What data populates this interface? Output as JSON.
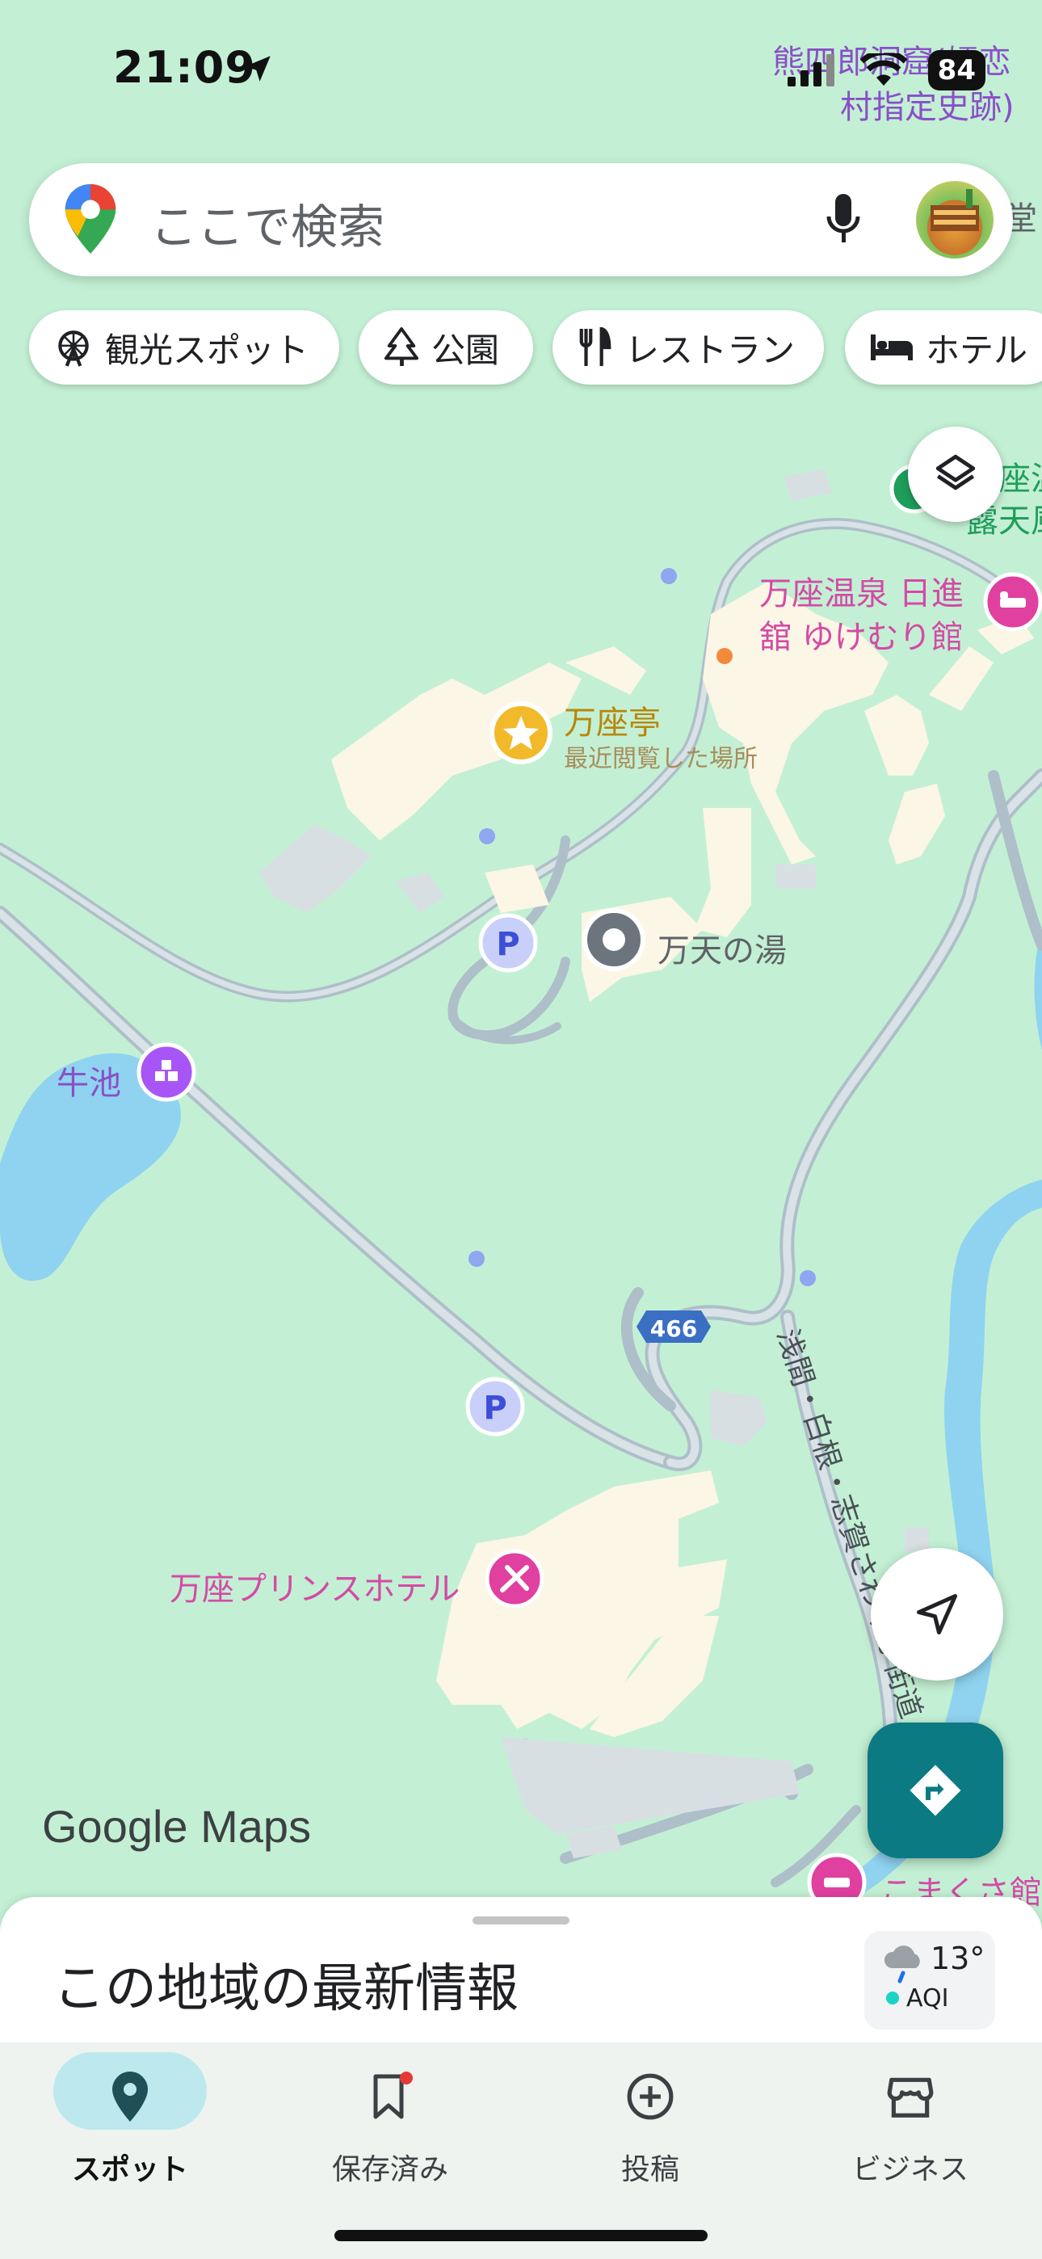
{
  "status_bar": {
    "time": "21:09",
    "battery": "84"
  },
  "search": {
    "placeholder": "ここで検索"
  },
  "chips": [
    {
      "label": "観光スポット",
      "icon": "ferris-wheel-icon"
    },
    {
      "label": "公園",
      "icon": "tree-icon"
    },
    {
      "label": "レストラン",
      "icon": "fork-knife-icon"
    },
    {
      "label": "ホテル",
      "icon": "bed-icon"
    }
  ],
  "map": {
    "labels": {
      "kumashiro": "熊四郎洞窟(嬬恋",
      "kumashiro2": "村指定史跡)",
      "do": "堂",
      "za_top": "座温",
      "rotenburo": "露天風",
      "nisshinkan1": "万座温泉 日進",
      "nisshinkan2": "舘 ゆけむり館",
      "manzatei": "万座亭",
      "recent": "最近閲覧した場所",
      "manten": "万天の湯",
      "ushiike": "牛池",
      "route": "466",
      "road_name": "浅間・白根・志賀さわやか街道",
      "prince": "万座プリンスホテル",
      "komakusa": "こまくさ館",
      "parking": "P"
    },
    "google_logo": "Google Maps"
  },
  "sheet": {
    "title": "この地域の最新情報",
    "temperature": "13°",
    "aqi": "AQI"
  },
  "nav": [
    {
      "label": "スポット",
      "icon": "location-pin-icon",
      "active": true
    },
    {
      "label": "保存済み",
      "icon": "bookmark-icon",
      "active": false
    },
    {
      "label": "投稿",
      "icon": "plus-circle-icon",
      "active": false
    },
    {
      "label": "ビジネス",
      "icon": "storefront-icon",
      "active": false
    }
  ],
  "colors": {
    "map_bg": "#c3f0d4",
    "accent_teal": "#0b7a83",
    "hotel_pink": "#e040a0",
    "poi_purple": "#a855f7",
    "water": "#8fd3f0"
  }
}
